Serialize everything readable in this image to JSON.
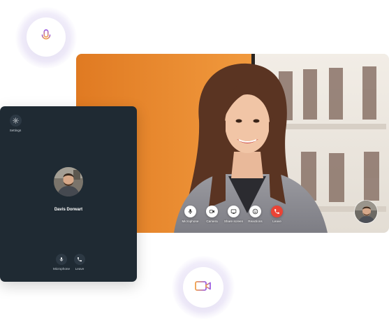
{
  "icons": {
    "mic_bubble": "microphone-icon",
    "camera_bubble": "video-camera-icon"
  },
  "colors": {
    "bubble_gradient_start": "#f2a04a",
    "bubble_gradient_end": "#9b5de5",
    "panel_bg": "#1f2a33",
    "leave_red": "#ea4335"
  },
  "main_call": {
    "controls": [
      {
        "label": "Microphone",
        "icon": "microphone-icon"
      },
      {
        "label": "Camera",
        "icon": "camera-icon"
      },
      {
        "label": "Share screen",
        "icon": "screen-share-icon"
      },
      {
        "label": "Reactions",
        "icon": "emoji-icon"
      },
      {
        "label": "Leave",
        "icon": "phone-hangup-icon"
      }
    ]
  },
  "side_panel": {
    "settings_label": "Settings",
    "caller_name": "Davis Dorwart",
    "controls": [
      {
        "label": "Microphone",
        "icon": "microphone-icon"
      },
      {
        "label": "Leave",
        "icon": "phone-icon"
      }
    ]
  }
}
